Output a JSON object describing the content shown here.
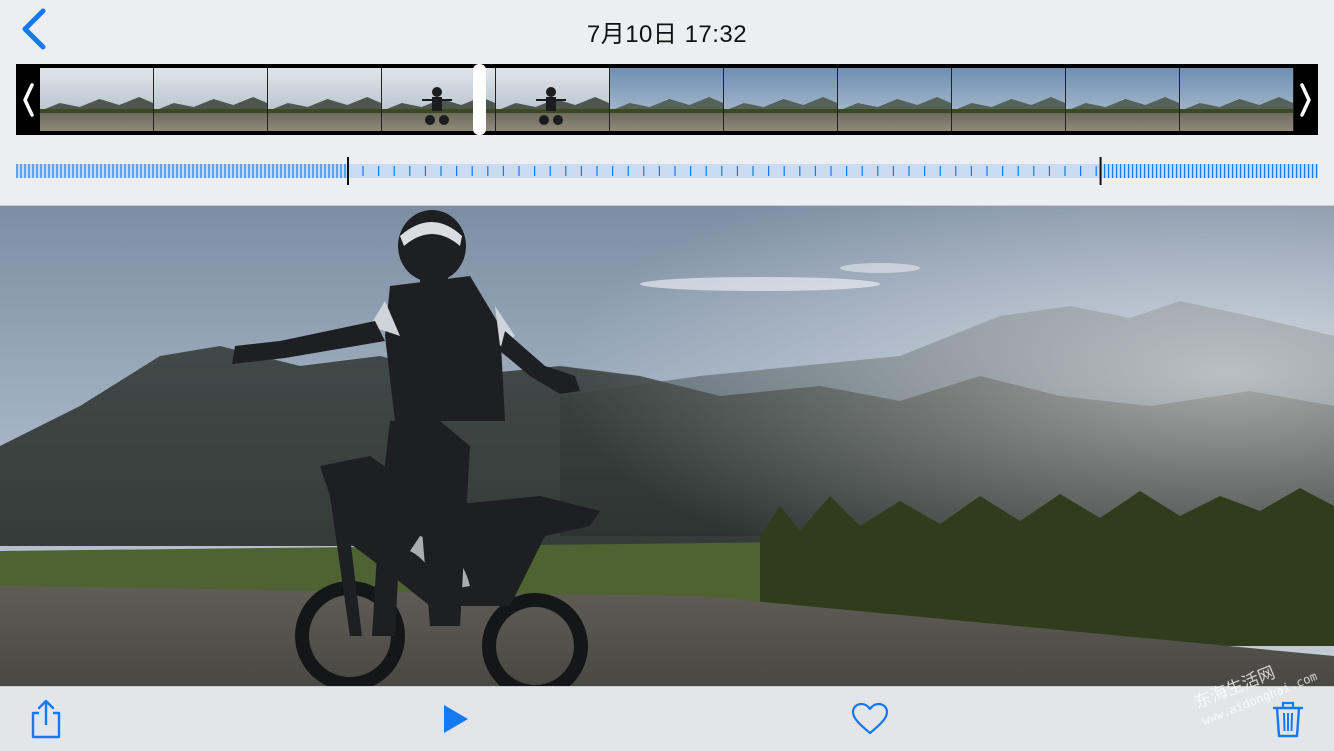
{
  "header": {
    "title": "7月10日  17:32",
    "back_icon": "chevron-left-icon"
  },
  "filmstrip": {
    "frame_count": 11,
    "trim_left_icon": "trim-handle-left-icon",
    "trim_right_icon": "trim-handle-right-icon",
    "playhead_position": 0.35
  },
  "scrubber": {
    "start_fraction": 0.255,
    "end_fraction": 0.833
  },
  "toolbar": {
    "share_icon": "share-icon",
    "play_icon": "play-icon",
    "favorite_icon": "heart-icon",
    "delete_icon": "trash-icon"
  },
  "watermark": {
    "line1": "东海生活网",
    "line2": "www.aidonghai.com"
  },
  "colors": {
    "accent": "#1479f3",
    "bar_background": "#eceef1"
  }
}
